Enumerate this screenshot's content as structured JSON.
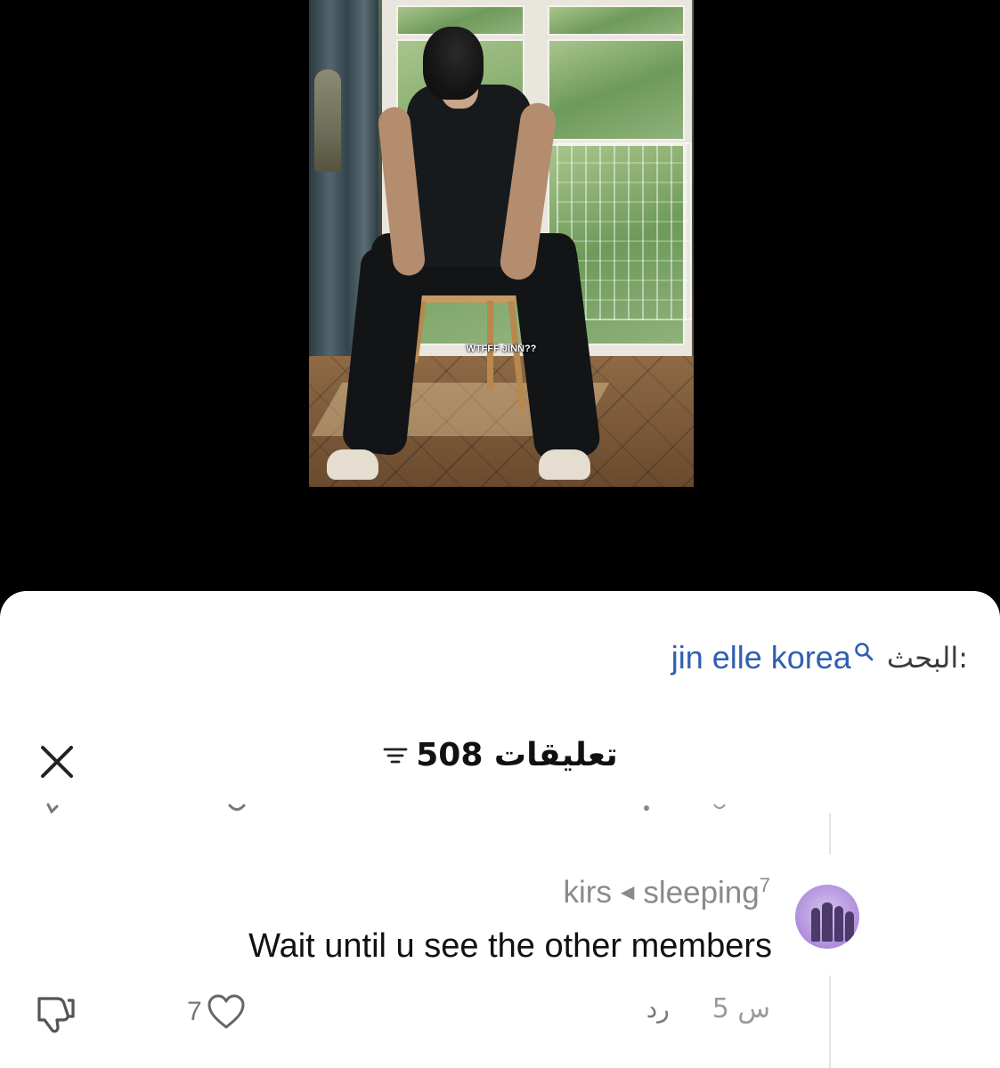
{
  "video": {
    "caption": "WTFFF JINN??"
  },
  "search": {
    "label": "البحث:",
    "query": "jin elle korea"
  },
  "comments": {
    "count_title": "508 تعليقات",
    "items": [
      {
        "author": "kirs",
        "reply_to": "sleeping",
        "reply_to_sup": "7",
        "text": "Wait until u see the other members",
        "time": "5 س",
        "reply_label": "رد",
        "likes": "7"
      }
    ]
  },
  "icons": {
    "search": "search-icon",
    "close": "close-icon",
    "sort": "sort-icon",
    "heart": "heart-icon",
    "dislike": "thumbs-down-icon",
    "reply_arrow": "triangle-left-icon"
  },
  "colors": {
    "link_blue": "#2f5fb3",
    "sheet_bg": "#ffffff",
    "video_bg": "#000000",
    "muted_text": "#8a8a8a"
  }
}
